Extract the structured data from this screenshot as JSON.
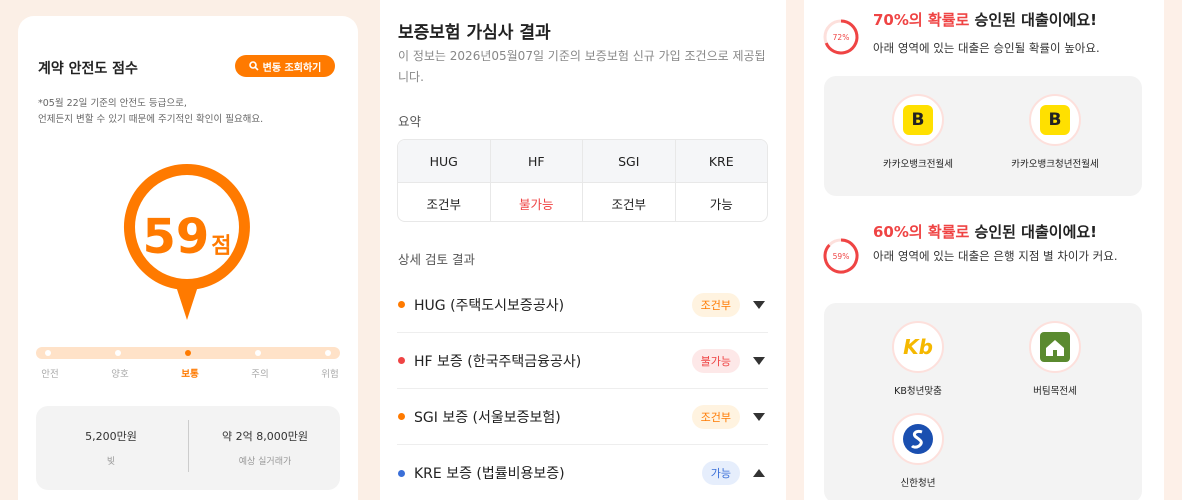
{
  "left": {
    "title": "계약 안전도 점수",
    "view_button": "변동 조회하기",
    "note_line1": "*05월 22일 기준의 안전도 등급으로,",
    "note_line2": "언제든지 변할 수 있기 때문에 주기적인 확인이 필요해요.",
    "score": "59",
    "score_unit": "점",
    "levels": [
      "안전",
      "양호",
      "보통",
      "주의",
      "위험"
    ],
    "active_level": "보통",
    "stats": [
      {
        "value": "5,200만원",
        "label": "빚"
      },
      {
        "value": "약 2억 8,000만원",
        "label": "예상 실거래가"
      }
    ],
    "colors": {
      "accent": "#ff7a00"
    }
  },
  "mid": {
    "title": "보증보험 가심사 결과",
    "desc": "이 정보는 2026년05월07일 기준의 보증보험 신규 가입 조건으로 제공됩니다.",
    "summary_label": "요약",
    "summary_headers": [
      "HUG",
      "HF",
      "SGI",
      "KRE"
    ],
    "summary_values": [
      "조건부",
      "불가능",
      "조건부",
      "가능"
    ],
    "detail_label": "상세 검토 결과",
    "details": [
      {
        "name": "HUG (주택도시보증공사)",
        "badge": "조건부",
        "dot_color": "#ff7a00"
      },
      {
        "name": "HF 보증 (한국주택금융공사)",
        "badge": "불가능",
        "dot_color": "#ef4444"
      },
      {
        "name": "SGI 보증 (서울보증보험)",
        "badge": "조건부",
        "dot_color": "#ff7a00"
      },
      {
        "name": "KRE 보증 (법률비용보증)",
        "badge": "가능",
        "dot_color": "#3a6fd8"
      }
    ]
  },
  "right": {
    "groups": [
      {
        "ring_label": "72%",
        "title_hi": "70%의 확률로",
        "title_rest": " 승인된 대출이에요!",
        "sub": "아래 영역에 있는 대출은 승인될 확률이 높아요.",
        "banks": [
          "카카오뱅크전월세",
          "카카오뱅크청년전월세"
        ]
      },
      {
        "ring_label": "59%",
        "title_hi": "60%의 확률로",
        "title_rest": " 승인된 대출이에요!",
        "sub": "아래 영역에 있는 대출은 은행 지점 별 차이가 커요.",
        "banks": [
          "KB청년맞춤",
          "버팀목전세",
          "신한청년"
        ]
      }
    ],
    "logo_texts": {
      "kakao": "B",
      "kb": "Kb"
    }
  }
}
